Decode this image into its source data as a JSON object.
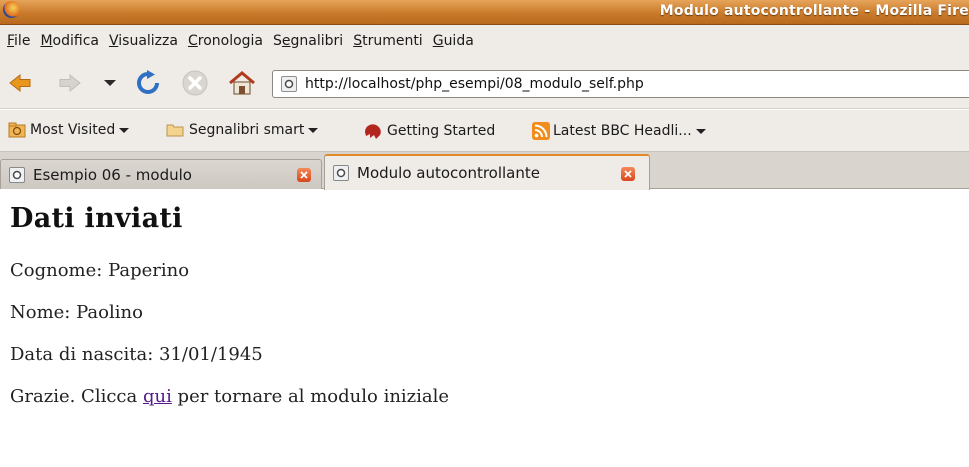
{
  "window": {
    "title": "Modulo autocontrollante - Mozilla Fire"
  },
  "menubar": {
    "items": [
      {
        "label": "File",
        "mnemonic": "F",
        "rest": "ile"
      },
      {
        "label": "Modifica",
        "mnemonic": "M",
        "rest": "odifica"
      },
      {
        "label": "Visualizza",
        "mnemonic": "V",
        "rest": "isualizza"
      },
      {
        "label": "Cronologia",
        "mnemonic": "C",
        "rest": "ronologia"
      },
      {
        "label": "Segnalibri",
        "pre": "S",
        "mnemonic": "e",
        "rest": "gnalibri"
      },
      {
        "label": "Strumenti",
        "mnemonic": "S",
        "rest": "trumenti"
      },
      {
        "label": "Guida",
        "mnemonic": "G",
        "rest": "uida"
      }
    ]
  },
  "navbar": {
    "url": "http://localhost/php_esempi/08_modulo_self.php",
    "icons": [
      "back-arrow-icon",
      "forward-arrow-icon",
      "history-dropdown-icon",
      "reload-icon",
      "stop-icon",
      "home-icon"
    ]
  },
  "bookmarks": {
    "items": [
      {
        "label": "Most Visited",
        "icon": "most-visited-icon",
        "dropdown": true
      },
      {
        "label": "Segnalibri smart",
        "icon": "folder-icon",
        "dropdown": true
      },
      {
        "label": "Getting Started",
        "icon": "firefox-red-icon",
        "dropdown": false
      },
      {
        "label": "Latest BBC Headli...",
        "icon": "rss-feed-icon",
        "dropdown": true
      }
    ]
  },
  "tabs": [
    {
      "label": "Esempio 06 - modulo",
      "active": false
    },
    {
      "label": "Modulo autocontrollante",
      "active": true
    }
  ],
  "page": {
    "heading": "Dati inviati",
    "cognome": "Cognome: Paperino",
    "nome": "Nome: Paolino",
    "data_nascita": "Data di nascita: 31/01/1945",
    "thanks_before": "Grazie. Clicca ",
    "link_text": "qui",
    "thanks_after": " per tornare al modulo iniziale"
  },
  "colors": {
    "titlebar": "#c97a2a",
    "chrome": "#efebe7",
    "link_visited": "#551a8b",
    "active_tab_accent": "#e08a2c"
  }
}
